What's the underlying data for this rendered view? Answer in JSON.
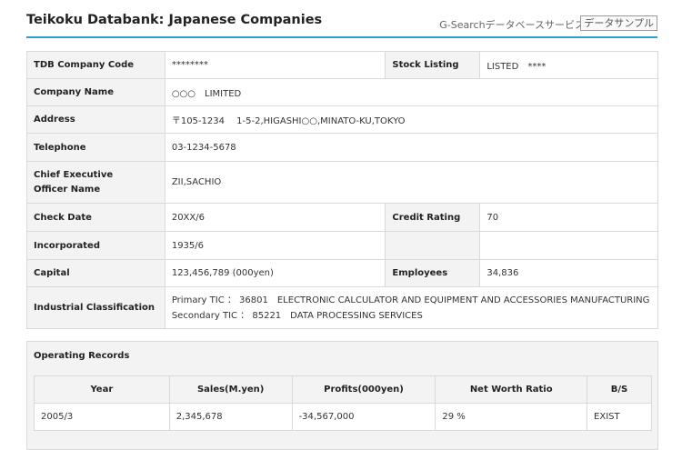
{
  "header": {
    "title": "Teikoku Databank: Japanese Companies",
    "service": "G-Searchデータベースサービス",
    "sample_button": "データサンプル"
  },
  "company": {
    "tdb_code_label": "TDB Company Code",
    "tdb_code": "********",
    "stock_listing_label": "Stock Listing",
    "stock_listing": "LISTED　****",
    "name_label": "Company Name",
    "name": "○○○　LIMITED",
    "address_label": "Address",
    "address": "〒105-1234　 1-5-2,HIGASHI○○,MINATO-KU,TOKYO",
    "telephone_label": "Telephone",
    "telephone": "03-1234-5678",
    "ceo_label_line1": "Chief Executive",
    "ceo_label_line2": "Officer Name",
    "ceo": "ZII,SACHIO",
    "check_date_label": "Check Date",
    "check_date": "20XX/6",
    "credit_rating_label": "Credit Rating",
    "credit_rating": "70",
    "incorporated_label": "Incorporated",
    "incorporated": "1935/6",
    "capital_label": "Capital",
    "capital": "123,456,789 (000yen)",
    "employees_label": "Employees",
    "employees": "34,836",
    "industry_label": "Industrial Classification",
    "industry_primary": "Primary TIC ： 36801　ELECTRONIC CALCULATOR AND EQUIPMENT AND ACCESSORIES MANUFACTURING",
    "industry_secondary": "Secondary TIC ： 85221　DATA PROCESSING SERVICES"
  },
  "operating_records": {
    "title": "Operating Records",
    "columns": [
      "Year",
      "Sales(M.yen)",
      "Profits(000yen)",
      "Net Worth Ratio",
      "B/S"
    ],
    "rows": [
      [
        "2005/3",
        "2,345,678",
        "-34,567,000",
        "29 %",
        "EXIST"
      ]
    ]
  }
}
